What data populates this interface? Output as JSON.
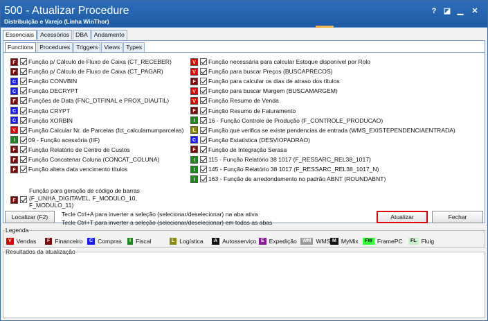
{
  "window": {
    "title": "500 - Atualizar Procedure",
    "subtitle": "Distribuição e Varejo (Linha WinThor)",
    "buttons": {
      "help": "?",
      "restore": "◪",
      "minimize": "▁",
      "close": "✕"
    }
  },
  "tabs_main": [
    "Essenciais",
    "Acessórios",
    "DBA",
    "Andamento"
  ],
  "tabs_sub": [
    "Functions",
    "Procedures",
    "Triggers",
    "Views",
    "Types"
  ],
  "left_items": [
    {
      "badge": "F",
      "label": "Função p/ Cálculo de Fluxo de Caixa (CT_RECEBER)"
    },
    {
      "badge": "F",
      "label": "Função p/ Cálculo de Fluxo de Caixa (CT_PAGAR)"
    },
    {
      "badge": "C",
      "label": "Função CONVBIN"
    },
    {
      "badge": "C",
      "label": "Função DECRYPT"
    },
    {
      "badge": "F",
      "label": "Funções de Data (FNC_DTFINAL e PROX_DIAUTIL)"
    },
    {
      "badge": "C",
      "label": "Função CRYPT"
    },
    {
      "badge": "C",
      "label": "Função XORBIN"
    },
    {
      "badge": "V",
      "label": "Função Calcular Nr. de Parcelas (fct_calcularnumparcelas)"
    },
    {
      "badge": "I",
      "label": "09 - Função acessória (IIF)"
    },
    {
      "badge": "F",
      "label": "Função Relatório de Centro de Custos"
    },
    {
      "badge": "F",
      "label": "Função Concatenar Coluna (CONCAT_COLUNA)"
    },
    {
      "badge": "F",
      "label": "Função altera data vencimento títulos"
    }
  ],
  "left_multi": {
    "badge": "F",
    "lines": [
      "Função para geração de código de barras",
      "(F_LINHA_DIGITAVEL, F_MODULO_10,",
      "F_MODULO_11)"
    ]
  },
  "right_items": [
    {
      "badge": "V",
      "label": "Função necessária para calcular Estoque disponível por Rolo"
    },
    {
      "badge": "V",
      "label": "Função para buscar Preços (BUSCAPRECOS)"
    },
    {
      "badge": "F",
      "label": "Função para calcular os dias de atraso dos títulos"
    },
    {
      "badge": "V",
      "label": "Função para buscar Margem (BUSCAMARGEM)"
    },
    {
      "badge": "V",
      "label": "Função Resumo de Venda"
    },
    {
      "badge": "F",
      "label": "Função Resumo de Faturamento"
    },
    {
      "badge": "I",
      "label": "16 - Função Controle de Produção (F_CONTROLE_PRODUCAO)"
    },
    {
      "badge": "L",
      "label": "Função que verifica se existe pendencias de entrada (WMS_EXISTEPENDENCIAENTRADA)"
    },
    {
      "badge": "C",
      "label": "Função Estatística (DESVIOPADRAO)"
    },
    {
      "badge": "F",
      "label": "Função de Integração Serasa"
    },
    {
      "badge": "I",
      "label": "115 - Função Relatório 38 1017 (F_RESSARC_REL38_1017)"
    },
    {
      "badge": "I",
      "label": "145 - Função Relatório 38 1017 (F_RESSARC_REL38_1017_N)"
    },
    {
      "badge": "I",
      "label": "163 - Função de arredondamento no padrão ABNT (ROUNDABNT)"
    }
  ],
  "badge_colors": {
    "V": "#e00000",
    "F": "#7a0a0a",
    "C": "#1a1aff",
    "I": "#1a8a1a",
    "L": "#8a8a10",
    "A": "#111111",
    "E": "#8a1a9a",
    "W": "#9a9a9a",
    "M": "#111111",
    "FW": "#33ff33",
    "FL": "#c8f0c8"
  },
  "localizar_label": "Localizar (F2)",
  "hint1": "Tecle Ctrl+A para inverter a seleção (selecionar/deselecionar) na aba ativa",
  "hint2": "Tecle Ctrl+T para inverter a seleção (selecionar/deselecionar) em todas as abas",
  "atualizar_label": "Atualizar",
  "fechar_label": "Fechar",
  "legend": {
    "title": "Legenda",
    "items": [
      {
        "code": "V",
        "label": "Vendas"
      },
      {
        "code": "F",
        "label": "Financeiro"
      },
      {
        "code": "C",
        "label": "Compras"
      },
      {
        "code": "I",
        "label": "Fiscal"
      },
      {
        "code": "L",
        "label": "Logística"
      },
      {
        "code": "A",
        "label": "Autosserviço"
      },
      {
        "code": "E",
        "label": "Expedição"
      },
      {
        "code": "W",
        "label": "WMS",
        "badge": "WM"
      },
      {
        "code": "M",
        "label": "MyMix"
      },
      {
        "code": "FW",
        "label": "FramePC"
      },
      {
        "code": "FL",
        "label": "Fluig"
      }
    ]
  },
  "results_title": "Resultados da atualização"
}
